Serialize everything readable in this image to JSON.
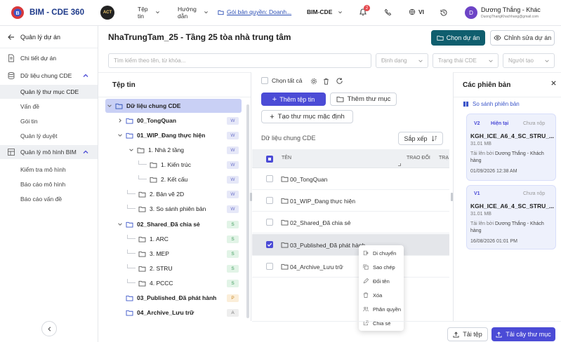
{
  "app": {
    "title": "BIM - CDE 360",
    "nav": {
      "files": "Tệp tin",
      "guide": "Hướng dẫn",
      "license": "Gói bản quyền: Doanh...",
      "project_selector": "BIM-CDE",
      "notification_count": "2",
      "language": "VI"
    },
    "user": {
      "avatar_letter": "D",
      "name": "Dương Thắng - Khác",
      "email": "DuongThangKhachhang@gmail.com"
    }
  },
  "sidebar": {
    "back_label": "Quản lý dự án",
    "items": [
      {
        "label": "Chi tiết dự án"
      },
      {
        "label": "Dữ liệu chung CDE"
      },
      {
        "label": "Quản lý thư mục CDE"
      },
      {
        "label": "Vấn đề"
      },
      {
        "label": "Gói tin"
      },
      {
        "label": "Quản lý duyệt"
      },
      {
        "label": "Quản lý mô hình BIM"
      },
      {
        "label": "Kiểm tra mô hình"
      },
      {
        "label": "Báo cáo mô hình"
      },
      {
        "label": "Báo cáo vấn đề"
      }
    ]
  },
  "main": {
    "title": "NhaTrungTam_25 - Tầng 25 tòa nhà trung tâm",
    "select_project_btn": "Chọn dự án",
    "edit_project_btn": "Chỉnh sửa dự án",
    "search_placeholder": "Tìm kiếm theo tên, từ khóa...",
    "filters": {
      "format": "Định dạng",
      "cde_status": "Trạng thái CDE",
      "creator": "Người tạo"
    }
  },
  "tree": {
    "title": "Tệp tin",
    "nodes": [
      {
        "label": "Dữ liệu chung CDE",
        "tag": ""
      },
      {
        "label": "00_TongQuan",
        "tag": "W"
      },
      {
        "label": "01_WIP_Đang thực hiện",
        "tag": "W"
      },
      {
        "label": "1. Nhà 2 tầng",
        "tag": "W"
      },
      {
        "label": "1. Kiến trúc",
        "tag": "W"
      },
      {
        "label": "2. Kết cấu",
        "tag": "W"
      },
      {
        "label": "2. Bản vẽ 2D",
        "tag": "W"
      },
      {
        "label": "3. So sánh phiên bản",
        "tag": "W"
      },
      {
        "label": "02_Shared_Đã chia sẻ",
        "tag": "S"
      },
      {
        "label": "1. ARC",
        "tag": "S"
      },
      {
        "label": "3. MEP",
        "tag": "S"
      },
      {
        "label": "2. STRU",
        "tag": "S"
      },
      {
        "label": "4. PCCC",
        "tag": "S"
      },
      {
        "label": "03_Published_Đã phát hành",
        "tag": "P"
      },
      {
        "label": "04_Archive_Lưu trữ",
        "tag": "A"
      }
    ]
  },
  "content": {
    "select_all": "Chọn tất cả",
    "add_file_btn": "Thêm tệp tin",
    "add_folder_btn": "Thêm thư mục",
    "create_default_btn": "Tạo thư mục mặc định",
    "breadcrumb": "Dữ liệu chung CDE",
    "sort_btn": "Sắp xếp",
    "columns": {
      "name": "TÊN",
      "exchange": "TRAO ĐỔI",
      "extra": "TRẠ"
    },
    "rows": [
      {
        "name": "00_TongQuan"
      },
      {
        "name": "01_WIP_Đang thực hiện"
      },
      {
        "name": "02_Shared_Đã chia sẻ"
      },
      {
        "name": "03_Published_Đã phát hành"
      },
      {
        "name": "04_Archive_Lưu trữ"
      }
    ],
    "context_menu": [
      "Di chuyển",
      "Sao chép",
      "Đổi tên",
      "Xóa",
      "Phân quyền",
      "Chia sẻ"
    ],
    "upload_file_btn": "Tải tệp",
    "upload_folder_btn": "Tải cây thư mục"
  },
  "versions": {
    "title": "Các phiên bản",
    "compare_link": "So sánh phiên bản",
    "cards": [
      {
        "version": "V2",
        "current": "Hiện tại",
        "status": "Chưa nộp",
        "name": "KGH_ICE_A6_4_SC_STRU_...",
        "size": "31.01 MB",
        "uploaded_by_label": "Tải lên bởi",
        "uploader": "Dương Thắng - Khách hàng",
        "date": "01/09/2026 12:38 AM"
      },
      {
        "version": "V1",
        "current": "",
        "status": "Chưa nộp",
        "name": "KGH_ICE_A6_4_SC_STRU_...",
        "size": "31.01 MB",
        "uploaded_by_label": "Tải lên bởi",
        "uploader": "Dương Thắng - Khách hàng",
        "date": "16/08/2026 01:01 PM"
      }
    ]
  },
  "colors": {
    "primary": "#0f5e6e",
    "accent": "#4b4bd6",
    "sidebar_active": "#eef0f3"
  }
}
